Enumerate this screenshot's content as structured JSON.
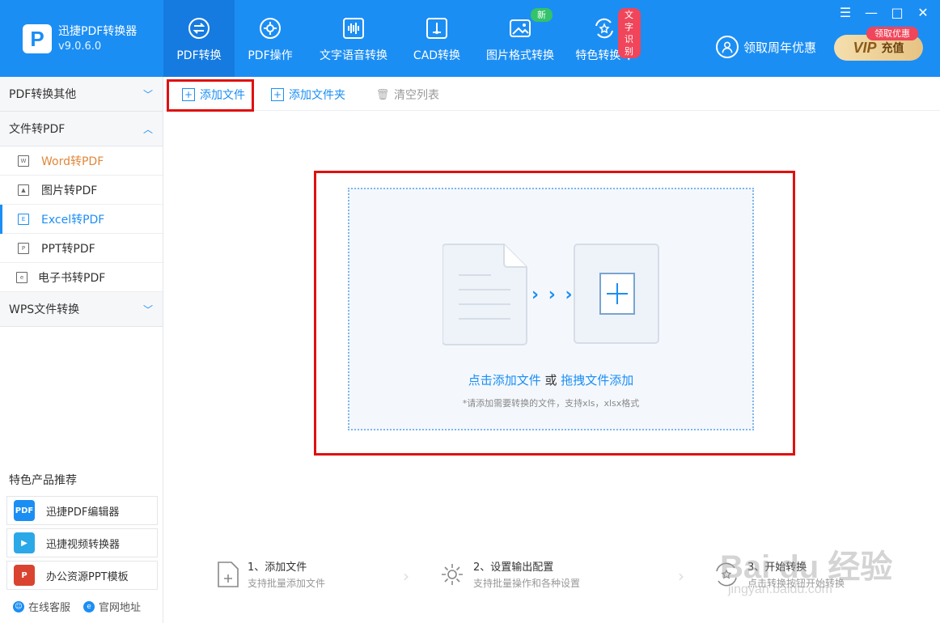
{
  "app": {
    "logo_letter": "P",
    "title": "迅捷PDF转换器",
    "version": "v9.0.6.0"
  },
  "nav": [
    {
      "label": "PDF转换",
      "active": true
    },
    {
      "label": "PDF操作"
    },
    {
      "label": "文字语音转换"
    },
    {
      "label": "CAD转换"
    },
    {
      "label": "图片格式转换",
      "badge": "新"
    },
    {
      "label": "特色转换 ▼",
      "badge": "文字识别"
    }
  ],
  "promo": {
    "label": "领取周年优惠",
    "vip": "VIP",
    "charge": "充值",
    "tag": "领取优惠"
  },
  "window": {
    "menu": "☰",
    "minimize": "—",
    "maximize": "□",
    "close": "✕"
  },
  "sidebar": {
    "sections": [
      {
        "label": "PDF转换其他",
        "chevron": "﹀"
      },
      {
        "label": "文件转PDF",
        "chevron": "︿"
      },
      {
        "label": "WPS文件转换",
        "chevron": "﹀"
      }
    ],
    "items": [
      {
        "label": "Word转PDF",
        "icon": "W"
      },
      {
        "label": "图片转PDF",
        "icon": "▲"
      },
      {
        "label": "Excel转PDF",
        "icon": "E"
      },
      {
        "label": "PPT转PDF",
        "icon": "P"
      },
      {
        "label": "电子书转PDF",
        "icon": "e"
      }
    ],
    "recommend_title": "特色产品推荐",
    "recommend": [
      {
        "label": "迅捷PDF编辑器",
        "icon_text": "PDF",
        "color": "#1b8ef4"
      },
      {
        "label": "迅捷视频转换器",
        "icon_text": "▶",
        "color": "#2aa8e8"
      },
      {
        "label": "办公资源PPT模板",
        "icon_text": "P",
        "color": "#d9432f"
      }
    ],
    "footer": [
      {
        "label": "在线客服",
        "icon": "☺"
      },
      {
        "label": "官网地址",
        "icon": "e"
      }
    ]
  },
  "toolbar": {
    "add_file": "添加文件",
    "add_folder": "添加文件夹",
    "clear": "清空列表",
    "plus": "+",
    "trash": "🗑"
  },
  "dropzone": {
    "click_add": "点击添加文件",
    "or": " 或 ",
    "drag_add": "拖拽文件添加",
    "hint": "*请添加需要转换的文件，支持xls，xlsx格式",
    "arrows": "› › ›"
  },
  "steps": [
    {
      "title": "1、添加文件",
      "desc": "支持批量添加文件"
    },
    {
      "title": "2、设置输出配置",
      "desc": "支持批量操作和各种设置"
    },
    {
      "title": "3、开始转换",
      "desc": "点击转换按钮开始转换"
    }
  ],
  "watermark": {
    "main": "Bai du 经验",
    "sub": "jingyan.baidu.com"
  },
  "colors": {
    "primary": "#1b8ef4",
    "highlight": "#e01010",
    "selected": "#e0873a"
  }
}
